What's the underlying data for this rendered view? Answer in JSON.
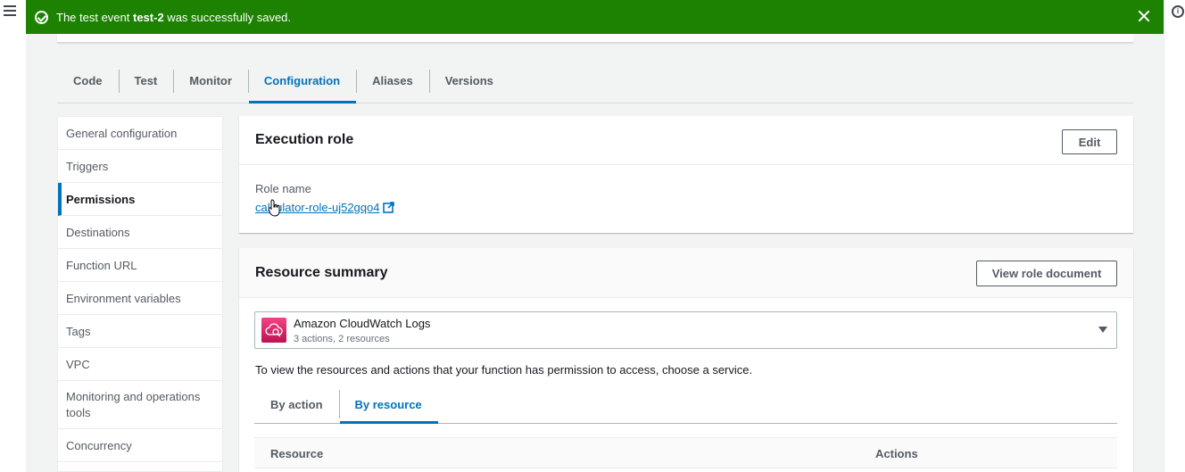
{
  "flash": {
    "prefix": "The test event ",
    "event_name": "test-2",
    "suffix": " was successfully saved."
  },
  "tabs": [
    {
      "label": "Code"
    },
    {
      "label": "Test"
    },
    {
      "label": "Monitor"
    },
    {
      "label": "Configuration",
      "active": true
    },
    {
      "label": "Aliases"
    },
    {
      "label": "Versions"
    }
  ],
  "sidenav": [
    {
      "label": "General configuration"
    },
    {
      "label": "Triggers"
    },
    {
      "label": "Permissions",
      "active": true
    },
    {
      "label": "Destinations"
    },
    {
      "label": "Function URL"
    },
    {
      "label": "Environment variables"
    },
    {
      "label": "Tags"
    },
    {
      "label": "VPC"
    },
    {
      "label": "Monitoring and operations tools"
    },
    {
      "label": "Concurrency"
    }
  ],
  "execution_role": {
    "title": "Execution role",
    "edit_label": "Edit",
    "role_name_label": "Role name",
    "role_name_value": "calculator-role-uj52gqo4"
  },
  "resource_summary": {
    "title": "Resource summary",
    "view_role_document_label": "View role document",
    "service": {
      "name": "Amazon CloudWatch Logs",
      "summary": "3 actions, 2 resources",
      "icon": "cloudwatch-logs-icon"
    },
    "help_text": "To view the resources and actions that your function has permission to access, choose a service.",
    "subtabs": [
      {
        "label": "By action"
      },
      {
        "label": "By resource",
        "active": true
      }
    ],
    "table_headers": {
      "resource": "Resource",
      "actions": "Actions"
    }
  },
  "colors": {
    "success": "#1d8102",
    "accent": "#0073bb"
  }
}
